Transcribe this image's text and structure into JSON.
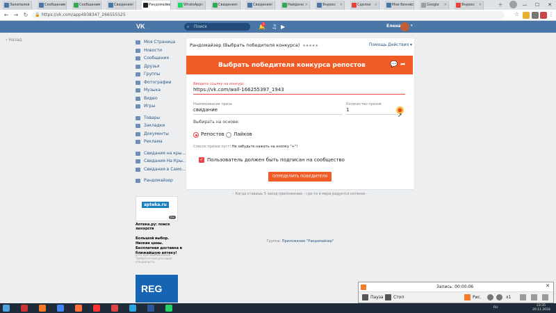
{
  "browser": {
    "tabs": [
      {
        "label": "Залипалка",
        "color": "#4a76a8"
      },
      {
        "label": "Сообщения",
        "color": "#4a76a8"
      },
      {
        "label": "Сообщения",
        "color": "#34a853"
      },
      {
        "label": "Свидания",
        "color": "#4a76a8"
      },
      {
        "label": "Рандомайзер",
        "color": "#222222",
        "active": true
      },
      {
        "label": "WhatsApp",
        "color": "#25d366"
      },
      {
        "label": "Свидания",
        "color": "#34a853"
      },
      {
        "label": "Свидания",
        "color": "#4a76a8"
      },
      {
        "label": "Найдено",
        "color": "#34a853"
      },
      {
        "label": "Яндекс",
        "color": "#4a76a8"
      },
      {
        "label": "Сделки",
        "color": "#ea4335"
      },
      {
        "label": "Мои бизнесы",
        "color": "#4a76a8"
      },
      {
        "label": "Google",
        "color": "#9aa0a6"
      },
      {
        "label": "Яндекс",
        "color": "#ea4335"
      }
    ],
    "url": "https://vk.com/app4938347_266555525",
    "window_controls": [
      "—",
      "☐",
      "✕"
    ]
  },
  "vk": {
    "logo": "VK",
    "search_placeholder": "Поиск",
    "notif_count": "1",
    "user_name": "Елена"
  },
  "nav": {
    "back": "Назад",
    "groups": [
      [
        "Моя Страница",
        "Новости",
        "Сообщения",
        "Друзья",
        "Группы",
        "Фотографии",
        "Музыка",
        "Видео",
        "Игры"
      ],
      [
        "Товары",
        "Закладки",
        "Документы",
        "Реклама"
      ],
      [
        "Свидания на кры...",
        "Свидания На Кры...",
        "Свидания в Само..."
      ],
      [
        "Рандомайзер"
      ]
    ]
  },
  "ads": {
    "ad1": {
      "logo": "apteka.ru",
      "age": "0+",
      "title": "Аптека.ру: поиск лекарств",
      "domain": "apteka.ru",
      "body": "Большой выбор. Низкие цены. Бесплатная доставка в ближайшую аптеку!",
      "disclaimer": "Есть противопоказания. Требуется консультация специалиста."
    },
    "ad2": {
      "logo": "REG"
    }
  },
  "app": {
    "title": "Рандомайзер (Выбрать победителя конкурса)",
    "rating": "★★★★★",
    "help": "Помощь",
    "actions": "Действия ▾",
    "banner_title": "Выбрать победителя конкурса репостов",
    "url_label": "Введите ссылку на конкурс",
    "url_value": "https://vk.com/wall-166255397_1943",
    "prize_label": "Наименование приза",
    "prize_value": "свидание",
    "count_label": "Количество призов",
    "count_value": "1",
    "choose_label": "Выбирать на основе:",
    "option_reposts": "Репостов",
    "option_likes": "Лайков",
    "empty_note": "Список призов пуст!",
    "empty_hint": "Не забудьте нажать на кнопку \"+\"!",
    "subscribe_label": "Пользователь должен быть подписан на сообщество",
    "button": "ОПРЕДЕЛИТЬ ПОБЕДИТЕЛЯ",
    "quote": "- Когда ставишь 5 звезд приложению - где-то в мире радуется котенок -",
    "footer_prefix": "Группа:",
    "footer_link": "Приложение \"Рандомайзер\""
  },
  "recorder": {
    "label": "Запись:",
    "time": "00:00:06",
    "pause": "Пауза",
    "stop": "Стоп",
    "draw": "Рис.",
    "zoom": "x1"
  },
  "taskbar": {
    "lang": "RU",
    "time": "23:35",
    "date": "20.11.2018"
  },
  "colors": {
    "vk_blue": "#4a76a8",
    "accent_orange": "#f15b26",
    "error_red": "#e64646"
  }
}
